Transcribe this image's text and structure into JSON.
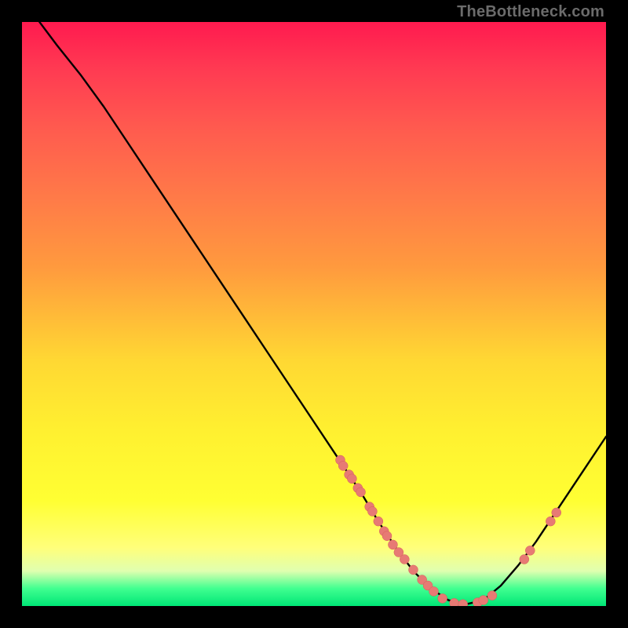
{
  "watermark": "TheBottleneck.com",
  "colors": {
    "page_bg": "#000000",
    "curve": "#000000",
    "dot_fill": "#e77a74",
    "dot_stroke": "#d55f58"
  },
  "chart_data": {
    "type": "line",
    "title": "",
    "xlabel": "",
    "ylabel": "",
    "xlim": [
      0,
      100
    ],
    "ylim": [
      0,
      100
    ],
    "grid": false,
    "series": [
      {
        "name": "bottleneck-curve",
        "x": [
          3,
          6,
          10,
          14,
          18,
          22,
          26,
          30,
          34,
          38,
          42,
          46,
          50,
          54,
          58,
          61,
          64,
          67,
          70,
          73,
          76,
          79,
          82,
          85,
          88,
          91,
          94,
          97,
          100
        ],
        "y": [
          100,
          96,
          91,
          85.5,
          79.5,
          73.5,
          67.5,
          61.5,
          55.5,
          49.5,
          43.5,
          37.5,
          31.5,
          25.5,
          19.5,
          14.5,
          10,
          6,
          3,
          1,
          0.3,
          1,
          3.5,
          7,
          11,
          15.5,
          20,
          24.5,
          29
        ]
      }
    ],
    "scatter": [
      {
        "name": "curve-dots",
        "points": [
          {
            "x": 54.5,
            "y": 25.0
          },
          {
            "x": 55.0,
            "y": 24.0
          },
          {
            "x": 56.0,
            "y": 22.5
          },
          {
            "x": 56.5,
            "y": 21.8
          },
          {
            "x": 57.5,
            "y": 20.2
          },
          {
            "x": 58.0,
            "y": 19.5
          },
          {
            "x": 59.5,
            "y": 17.0
          },
          {
            "x": 60.0,
            "y": 16.2
          },
          {
            "x": 61.0,
            "y": 14.5
          },
          {
            "x": 62.0,
            "y": 12.8
          },
          {
            "x": 62.5,
            "y": 12.0
          },
          {
            "x": 63.5,
            "y": 10.5
          },
          {
            "x": 64.5,
            "y": 9.2
          },
          {
            "x": 65.5,
            "y": 8.0
          },
          {
            "x": 67.0,
            "y": 6.2
          },
          {
            "x": 68.5,
            "y": 4.5
          },
          {
            "x": 69.5,
            "y": 3.5
          },
          {
            "x": 70.5,
            "y": 2.5
          },
          {
            "x": 72.0,
            "y": 1.3
          },
          {
            "x": 74.0,
            "y": 0.5
          },
          {
            "x": 75.5,
            "y": 0.3
          },
          {
            "x": 78.0,
            "y": 0.6
          },
          {
            "x": 79.0,
            "y": 1.0
          },
          {
            "x": 80.5,
            "y": 1.8
          },
          {
            "x": 86.0,
            "y": 8.0
          },
          {
            "x": 87.0,
            "y": 9.5
          },
          {
            "x": 90.5,
            "y": 14.5
          },
          {
            "x": 91.5,
            "y": 16.0
          }
        ]
      }
    ]
  }
}
